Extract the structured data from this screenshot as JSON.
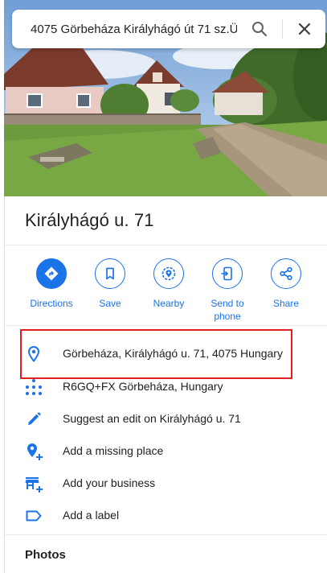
{
  "search": {
    "value": "4075 Görbeháza Királyhágó út 71 sz.Ü",
    "placeholder": "Search Google Maps"
  },
  "place": {
    "title": "Királyhágó u. 71"
  },
  "actions": [
    {
      "label": "Directions",
      "icon": "directions-icon"
    },
    {
      "label": "Save",
      "icon": "bookmark-icon"
    },
    {
      "label": "Nearby",
      "icon": "nearby-icon"
    },
    {
      "label": "Send to phone",
      "label_line1": "Send to",
      "label_line2": "phone",
      "icon": "send-to-phone-icon"
    },
    {
      "label": "Share",
      "icon": "share-icon"
    }
  ],
  "info": {
    "address": "Görbeháza, Királyhágó u. 71, 4075 Hungary",
    "plus_code": "R6GQ+FX Görbeháza, Hungary",
    "suggest_edit": "Suggest an edit on Királyhágó u. 71",
    "add_missing_place": "Add a missing place",
    "add_business": "Add your business",
    "add_label": "Add a label"
  },
  "photos_heading": "Photos",
  "colors": {
    "accent": "#1a73e8",
    "highlight_box": "#e41e1e",
    "text": "#202124"
  }
}
